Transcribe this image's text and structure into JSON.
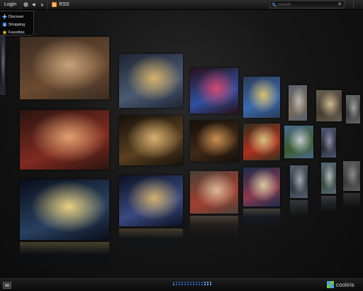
{
  "toolbar": {
    "login_label": "Login",
    "settings_icon": "gear-icon",
    "volume_icon": "speaker-icon",
    "next_icon": "play-next-icon",
    "feed_label": "RSS",
    "feed_icon": "rss-icon",
    "search_placeholder": "Search",
    "search_icon": "search-icon",
    "clear_icon": "close-icon"
  },
  "menu": {
    "items": [
      {
        "label": "Discover",
        "icon": "discover-icon"
      },
      {
        "label": "Shopping",
        "icon": "shopping-icon"
      },
      {
        "label": "Favorites",
        "icon": "star-icon"
      }
    ]
  },
  "wall": {
    "photos": [
      {
        "name": "photo-shop-street",
        "colors": [
          "#3a2d22",
          "#c7a37a",
          "#6b4a30"
        ]
      },
      {
        "name": "photo-bikes-night",
        "colors": [
          "#1e2433",
          "#d8b36a",
          "#4a5a72"
        ]
      },
      {
        "name": "photo-ferris-lights",
        "colors": [
          "#2a0f18",
          "#d04870",
          "#3050a0"
        ]
      },
      {
        "name": "photo-market-stall",
        "colors": [
          "#2a3a55",
          "#d8c070",
          "#3a6ab0"
        ]
      },
      {
        "name": "photo-tower-day",
        "colors": [
          "#5a6070",
          "#b8b8b0",
          "#7a6a58"
        ]
      },
      {
        "name": "photo-building-shop",
        "colors": [
          "#6a6050",
          "#d0b890",
          "#443c32"
        ]
      },
      {
        "name": "photo-gray-street",
        "colors": [
          "#6a6a6a",
          "#a0a0a0",
          "#3a3a3a"
        ]
      },
      {
        "name": "photo-kiosk-night",
        "colors": [
          "#2a1410",
          "#e0a070",
          "#802a20"
        ]
      },
      {
        "name": "photo-palace-facade",
        "colors": [
          "#15100a",
          "#d8b070",
          "#5a4020"
        ]
      },
      {
        "name": "photo-arcade-lights",
        "colors": [
          "#140e08",
          "#c89050",
          "#402818"
        ]
      },
      {
        "name": "photo-shop-window",
        "colors": [
          "#30301c",
          "#d8c080",
          "#b03020"
        ]
      },
      {
        "name": "photo-trees-road",
        "colors": [
          "#4a6a90",
          "#c0c8d0",
          "#3a5a2a"
        ]
      },
      {
        "name": "photo-bridge-dusk",
        "colors": [
          "#505870",
          "#8a90a8",
          "#2a2a38"
        ]
      },
      {
        "name": "photo-night-harbor",
        "colors": [
          "#0a0e1a",
          "#e8d080",
          "#284060"
        ]
      },
      {
        "name": "photo-city-lights",
        "colors": [
          "#0c1020",
          "#d0b070",
          "#3a4a80"
        ]
      },
      {
        "name": "photo-storefronts",
        "colors": [
          "#4a4038",
          "#d8b898",
          "#a04030"
        ]
      },
      {
        "name": "photo-shop-shelves",
        "colors": [
          "#1a2a4a",
          "#d8c8a0",
          "#8a3a50"
        ]
      },
      {
        "name": "photo-lamppost",
        "colors": [
          "#586070",
          "#a0a8b0",
          "#303840"
        ]
      },
      {
        "name": "photo-river-trees",
        "colors": [
          "#5a6878",
          "#b0b8c0",
          "#3a4a3a"
        ]
      },
      {
        "name": "photo-gray-square",
        "colors": [
          "#5a5a5a",
          "#8a8a8a",
          "#3a3a3a"
        ]
      },
      {
        "name": "photo-left-edge",
        "colors": [
          "#2a2a32",
          "#6a6a7a",
          "#15151a"
        ]
      }
    ]
  },
  "bottombar": {
    "view_toggle_icon": "grid-view-icon",
    "brand_name": "cooliris",
    "brand_icon": "cooliris-logo-icon",
    "scrubber_dots": 28,
    "scrubber_active": [
      11,
      12,
      13,
      14,
      25,
      26,
      27
    ]
  }
}
